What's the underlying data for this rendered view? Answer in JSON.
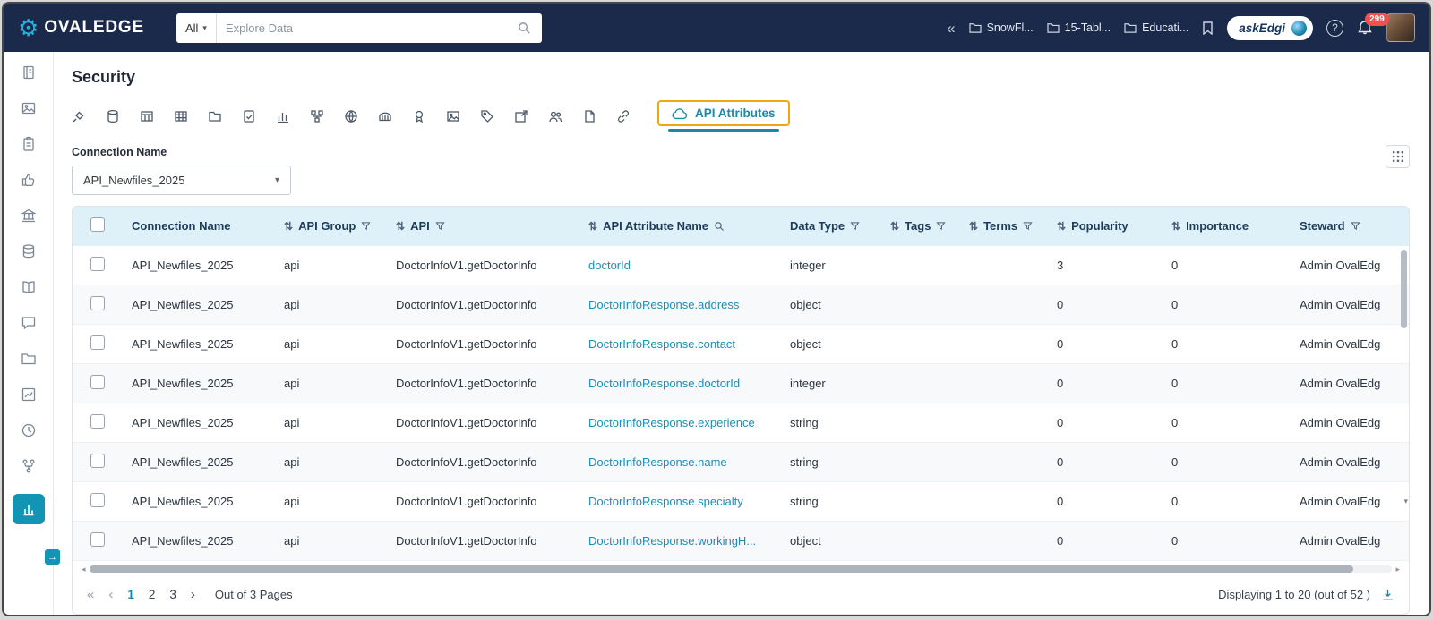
{
  "topbar": {
    "brand_text": "OVALEDGE",
    "search": {
      "scope": "All",
      "placeholder": "Explore Data"
    },
    "pinned": [
      {
        "label": "SnowFl..."
      },
      {
        "label": "15-Tabl..."
      },
      {
        "label": "Educati..."
      }
    ],
    "askedgi_label": "askEdgi",
    "help_label": "?",
    "notification_count": "299"
  },
  "sidebar": {
    "icons": [
      "notebook",
      "image",
      "clipboard",
      "thumbs-up",
      "bank",
      "database",
      "book",
      "chat",
      "folder",
      "chart",
      "clock",
      "branch",
      "dashboard"
    ],
    "active_icon": "dashboard"
  },
  "page": {
    "title": "Security",
    "tab_icons": [
      "connector",
      "database",
      "table",
      "columns",
      "folder",
      "query-sheet",
      "report-chart",
      "schema",
      "globe",
      "data-catalog",
      "certificate",
      "image",
      "tag",
      "export",
      "users",
      "file",
      "link"
    ],
    "active_tab": {
      "label": "API Attributes",
      "icon": "cloud"
    },
    "filter": {
      "label": "Connection Name",
      "value": "API_Newfiles_2025"
    }
  },
  "table": {
    "columns": [
      {
        "label": "Connection Name"
      },
      {
        "label": "API Group",
        "sort": true,
        "filter": true
      },
      {
        "label": "API",
        "sort": true,
        "filter": true
      },
      {
        "label": "API Attribute Name",
        "sort": true,
        "search": true
      },
      {
        "label": "Data Type",
        "filter": true
      },
      {
        "label": "Tags",
        "sort": true,
        "filter": true
      },
      {
        "label": "Terms",
        "sort": true,
        "filter": true
      },
      {
        "label": "Popularity",
        "sort": true
      },
      {
        "label": "Importance",
        "sort": true
      },
      {
        "label": "Steward",
        "filter": true
      }
    ],
    "rows": [
      {
        "connection": "API_Newfiles_2025",
        "group": "api",
        "api": "DoctorInfoV1.getDoctorInfo",
        "attribute": "doctorId",
        "data_type": "integer",
        "tags": "",
        "terms": "",
        "popularity": "3",
        "importance": "0",
        "steward": "Admin OvalEdg"
      },
      {
        "connection": "API_Newfiles_2025",
        "group": "api",
        "api": "DoctorInfoV1.getDoctorInfo",
        "attribute": "DoctorInfoResponse.address",
        "data_type": "object",
        "tags": "",
        "terms": "",
        "popularity": "0",
        "importance": "0",
        "steward": "Admin OvalEdg"
      },
      {
        "connection": "API_Newfiles_2025",
        "group": "api",
        "api": "DoctorInfoV1.getDoctorInfo",
        "attribute": "DoctorInfoResponse.contact",
        "data_type": "object",
        "tags": "",
        "terms": "",
        "popularity": "0",
        "importance": "0",
        "steward": "Admin OvalEdg"
      },
      {
        "connection": "API_Newfiles_2025",
        "group": "api",
        "api": "DoctorInfoV1.getDoctorInfo",
        "attribute": "DoctorInfoResponse.doctorId",
        "data_type": "integer",
        "tags": "",
        "terms": "",
        "popularity": "0",
        "importance": "0",
        "steward": "Admin OvalEdg"
      },
      {
        "connection": "API_Newfiles_2025",
        "group": "api",
        "api": "DoctorInfoV1.getDoctorInfo",
        "attribute": "DoctorInfoResponse.experience",
        "data_type": "string",
        "tags": "",
        "terms": "",
        "popularity": "0",
        "importance": "0",
        "steward": "Admin OvalEdg"
      },
      {
        "connection": "API_Newfiles_2025",
        "group": "api",
        "api": "DoctorInfoV1.getDoctorInfo",
        "attribute": "DoctorInfoResponse.name",
        "data_type": "string",
        "tags": "",
        "terms": "",
        "popularity": "0",
        "importance": "0",
        "steward": "Admin OvalEdg"
      },
      {
        "connection": "API_Newfiles_2025",
        "group": "api",
        "api": "DoctorInfoV1.getDoctorInfo",
        "attribute": "DoctorInfoResponse.specialty",
        "data_type": "string",
        "tags": "",
        "terms": "",
        "popularity": "0",
        "importance": "0",
        "steward": "Admin OvalEdg"
      },
      {
        "connection": "API_Newfiles_2025",
        "group": "api",
        "api": "DoctorInfoV1.getDoctorInfo",
        "attribute": "DoctorInfoResponse.workingH...",
        "data_type": "object",
        "tags": "",
        "terms": "",
        "popularity": "0",
        "importance": "0",
        "steward": "Admin OvalEdg"
      }
    ]
  },
  "pagination": {
    "pages": [
      "1",
      "2",
      "3"
    ],
    "current_page": "1",
    "label": "Out of 3 Pages",
    "display_info": "Displaying 1 to 20  (out of 52 )"
  }
}
